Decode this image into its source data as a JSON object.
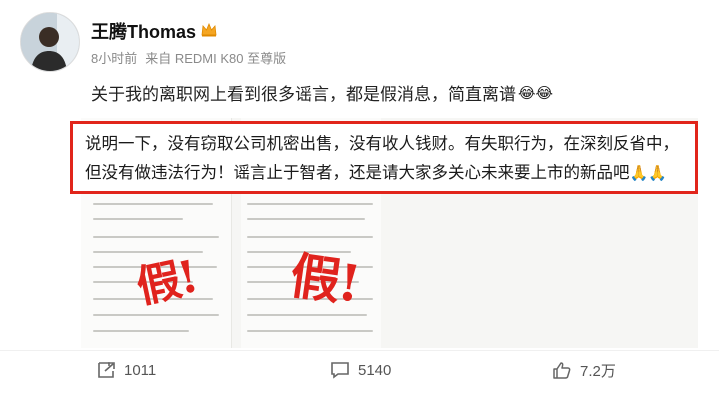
{
  "post": {
    "author": "王腾Thomas",
    "meta": {
      "time": "8小时前",
      "source": "来自 REDMI K80 至尊版"
    },
    "headline": "关于我的离职网上看到很多谣言，都是假消息，简直离谱",
    "headline_emoji": "😂😂",
    "statement_line1": "说明一下，没有窃取公司机密出售，没有收人钱财。有失职行为，在深刻反省中，",
    "statement_line2": "但没有做违法行为！谣言止于智者，还是请大家多关心未来要上市的新品吧",
    "statement_emoji": "🙏🙏",
    "stamp_left": "假!",
    "stamp_right": "假!",
    "accent_color": "#e1251b"
  },
  "footer": {
    "repost_count": "1011",
    "comment_count": "5140",
    "like_count": "7.2万"
  }
}
